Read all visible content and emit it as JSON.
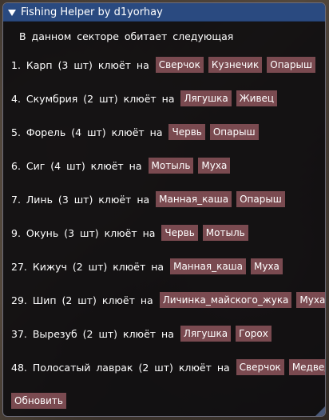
{
  "window": {
    "title": "Fishing Helper by d1yorhay"
  },
  "header_text": "В данном секторе обитает следующая",
  "fish": [
    {
      "text": "1. Карп (3 шт) клюёт на",
      "baits": [
        "Сверчок",
        "Кузнечик",
        "Опарыш"
      ]
    },
    {
      "text": "4. Скумбрия (2 шт) клюёт на",
      "baits": [
        "Лягушка",
        "Живец"
      ]
    },
    {
      "text": "5. Форель (4 шт) клюёт на",
      "baits": [
        "Червь",
        "Опарыш"
      ]
    },
    {
      "text": "6. Сиг (4 шт) клюёт на",
      "baits": [
        "Мотыль",
        "Муха"
      ]
    },
    {
      "text": "7. Линь (3 шт) клюёт на",
      "baits": [
        "Манная_каша",
        "Опарыш"
      ]
    },
    {
      "text": "9. Окунь (3 шт) клюёт на",
      "baits": [
        "Червь",
        "Мотыль"
      ]
    },
    {
      "text": "27. Кижуч (2 шт) клюёт на",
      "baits": [
        "Манная_каша",
        "Муха"
      ]
    },
    {
      "text": "29. Шип (2 шт) клюёт на",
      "baits": [
        "Личинка_майского_жука",
        "Муха"
      ]
    },
    {
      "text": "37. Вырезуб (2 шт) клюёт на",
      "baits": [
        "Лягушка",
        "Горох"
      ]
    },
    {
      "text": "48. Полосатый лаврак (2 шт) клюёт на",
      "baits": [
        "Сверчок",
        "Медведка"
      ]
    }
  ],
  "refresh_label": "Обновить",
  "colors": {
    "titlebar": "#2a4a80",
    "button": "#7a4a50",
    "window_bg": "#0e0d0f"
  }
}
